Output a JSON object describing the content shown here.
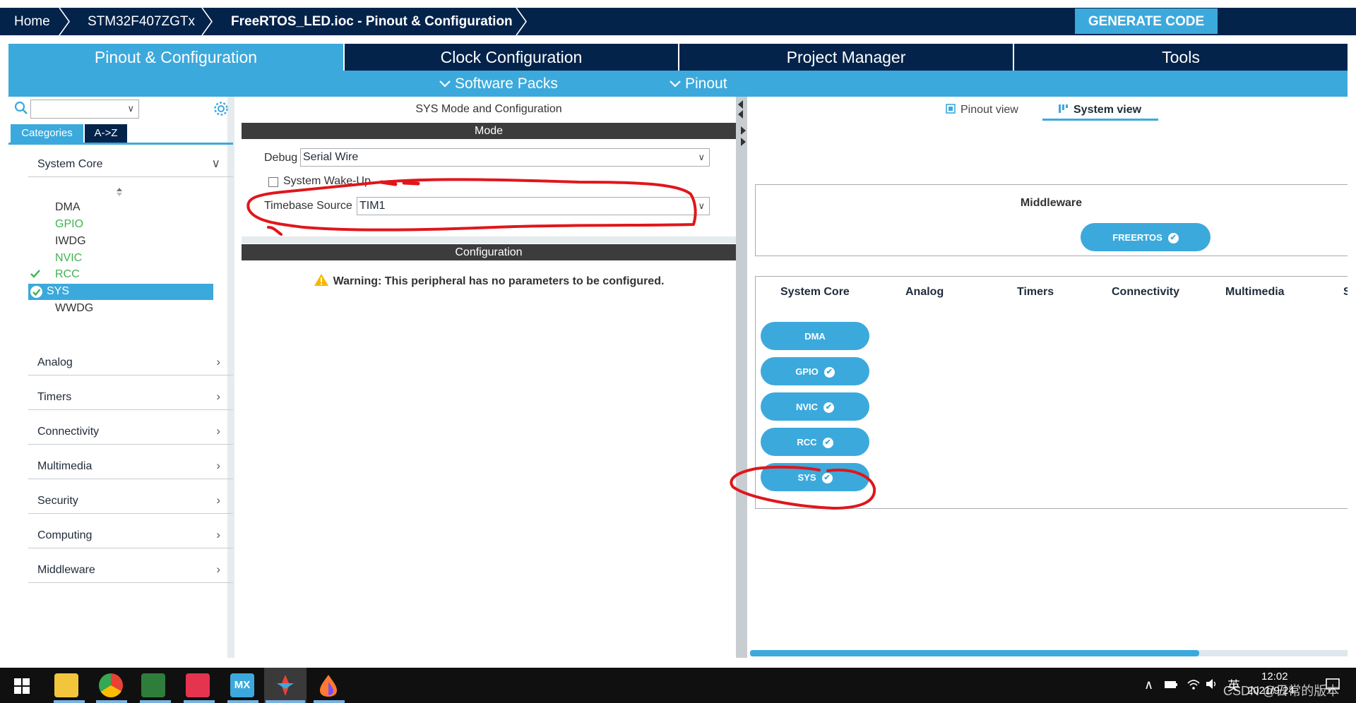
{
  "breadcrumb": {
    "home": "Home",
    "device": "STM32F407ZGTx",
    "file": "FreeRTOS_LED.ioc - Pinout & Configuration"
  },
  "toolbar": {
    "generate_label": "GENERATE CODE"
  },
  "main_tabs": [
    {
      "label": "Pinout & Configuration",
      "active": true
    },
    {
      "label": "Clock Configuration",
      "active": false
    },
    {
      "label": "Project Manager",
      "active": false
    },
    {
      "label": "Tools",
      "active": false
    }
  ],
  "sub_tabs": {
    "software_packs": "Software Packs",
    "pinout": "Pinout"
  },
  "left": {
    "tab_categories": "Categories",
    "tab_az": "A->Z",
    "search_value": "",
    "system_core_label": "System Core",
    "peripherals": [
      {
        "label": "DMA",
        "state": "normal"
      },
      {
        "label": "GPIO",
        "state": "enabled"
      },
      {
        "label": "IWDG",
        "state": "normal"
      },
      {
        "label": "NVIC",
        "state": "enabled"
      },
      {
        "label": "RCC",
        "state": "configured"
      },
      {
        "label": "SYS",
        "state": "selected"
      },
      {
        "label": "WWDG",
        "state": "normal"
      }
    ],
    "categories": [
      "Analog",
      "Timers",
      "Connectivity",
      "Multimedia",
      "Security",
      "Computing",
      "Middleware"
    ]
  },
  "mid": {
    "title": "SYS Mode and Configuration",
    "mode_header": "Mode",
    "debug_label": "Debug",
    "debug_value": "Serial Wire",
    "wakeup_label": "System Wake-Up",
    "timebase_label": "Timebase Source",
    "timebase_value": "TIM1",
    "config_header": "Configuration",
    "warning": "Warning: This peripheral has no parameters to be configured."
  },
  "right": {
    "pinout_view": "Pinout view",
    "system_view": "System view",
    "middleware_title": "Middleware",
    "middleware_button": "FREERTOS",
    "columns": [
      "System Core",
      "Analog",
      "Timers",
      "Connectivity",
      "Multimedia",
      "S"
    ],
    "core_buttons": [
      {
        "label": "DMA",
        "checked": false
      },
      {
        "label": "GPIO",
        "checked": true
      },
      {
        "label": "NVIC",
        "checked": true
      },
      {
        "label": "RCC",
        "checked": true
      },
      {
        "label": "SYS",
        "checked": true
      }
    ]
  },
  "taskbar": {
    "time": "12:02",
    "date": "2021/9/24",
    "ime": "英",
    "watermark": "CSDN @日常的版本",
    "mx_label": "MX"
  },
  "colors": {
    "navy": "#03234b",
    "accent": "#3ca9dc",
    "green": "#3fb34f",
    "annotation": "#e0161b"
  }
}
